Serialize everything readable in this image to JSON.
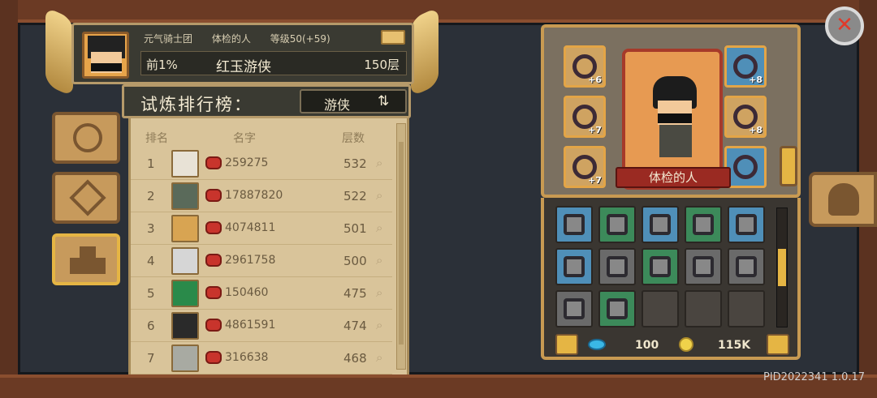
{
  "player": {
    "guild": "元气骑士团",
    "title": "体检的人",
    "level": "等级50(+59)",
    "rank_percent": "前1%",
    "name": "红玉游侠",
    "floor": "150层"
  },
  "leaderboard": {
    "title": "试炼排行榜：",
    "class_filter": "游侠",
    "swap_icon": "swap-icon",
    "headers": {
      "rank": "排名",
      "name": "名字",
      "floors": "层数"
    },
    "rows": [
      {
        "rank": "1",
        "id": "259275",
        "floors": "532",
        "avatar_color": "#e8e2d6"
      },
      {
        "rank": "2",
        "id": "17887820",
        "floors": "522",
        "avatar_color": "#5a6a5a"
      },
      {
        "rank": "3",
        "id": "4074811",
        "floors": "501",
        "avatar_color": "#d8a452"
      },
      {
        "rank": "4",
        "id": "2961758",
        "floors": "500",
        "avatar_color": "#d6d6d6"
      },
      {
        "rank": "5",
        "id": "150460",
        "floors": "475",
        "avatar_color": "#2a8a4a"
      },
      {
        "rank": "6",
        "id": "4861591",
        "floors": "474",
        "avatar_color": "#2a2a2a"
      },
      {
        "rank": "7",
        "id": "316638",
        "floors": "468",
        "avatar_color": "#a8aaa2"
      }
    ]
  },
  "equipment": {
    "character_name": "体检的人",
    "slots_left": [
      {
        "level": "+6",
        "color": "#cfa361"
      },
      {
        "level": "+7",
        "color": "#cfa361"
      },
      {
        "level": "+7",
        "color": "#cfa361"
      }
    ],
    "slots_right": [
      {
        "level": "+8",
        "color": "#4f8fb8"
      },
      {
        "level": "+8",
        "color": "#cfa361"
      },
      {
        "level": "",
        "color": "#4f8fb8"
      }
    ]
  },
  "inventory": {
    "slots": [
      "#4f8fb8",
      "#3c8a5a",
      "#4f8fb8",
      "#3c8a5a",
      "#4f8fb8",
      "#4f8fb8",
      "#6a6a6a",
      "#3c8a5a",
      "#6a6a6a",
      "#6a6a6a",
      "#6a6a6a",
      "#3c8a5a",
      "",
      "",
      ""
    ],
    "gems": "100",
    "coins": "115K"
  },
  "version": "PID2022341 1.0.17"
}
